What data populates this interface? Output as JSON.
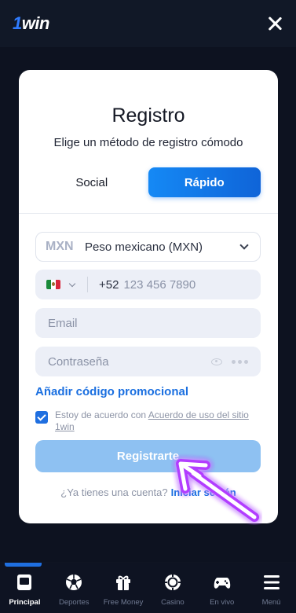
{
  "header": {
    "logo_prefix": "1",
    "logo_text": "win"
  },
  "modal": {
    "title": "Registro",
    "subtitle": "Elige un método de registro cómodo",
    "tabs": [
      {
        "label": "Social",
        "active": false
      },
      {
        "label": "Rápido",
        "active": true
      }
    ],
    "currency": {
      "code": "MXN",
      "name": "Peso mexicano (MXN)"
    },
    "phone": {
      "country_flag": "mexico-flag-icon",
      "prefix": "+52",
      "placeholder": "123 456 7890"
    },
    "email": {
      "placeholder": "Email"
    },
    "password": {
      "placeholder": "Contraseña"
    },
    "promo_label": "Añadir código promocional",
    "terms": {
      "checked": true,
      "prefix": "Estoy de acuerdo con ",
      "link": "Acuerdo de uso del sitio 1win"
    },
    "register_label": "Registrarte",
    "login_prompt": "¿Ya tienes una cuenta?",
    "login_link": "Iniciar sesión"
  },
  "colors": {
    "accent": "#1a6fe0",
    "button_disabled": "#8ec1f2",
    "background": "#0f1422",
    "arrow": "#c14dff"
  },
  "nav": [
    {
      "label": "Principal",
      "icon": "home-tile-icon",
      "active": true
    },
    {
      "label": "Deportes",
      "icon": "soccer-ball-icon",
      "active": false
    },
    {
      "label": "Free Money",
      "icon": "gift-icon",
      "active": false
    },
    {
      "label": "Casino",
      "icon": "poker-chip-icon",
      "active": false
    },
    {
      "label": "En vivo",
      "icon": "gamepad-icon",
      "active": false
    },
    {
      "label": "Menú",
      "icon": "menu-icon",
      "active": false
    }
  ]
}
